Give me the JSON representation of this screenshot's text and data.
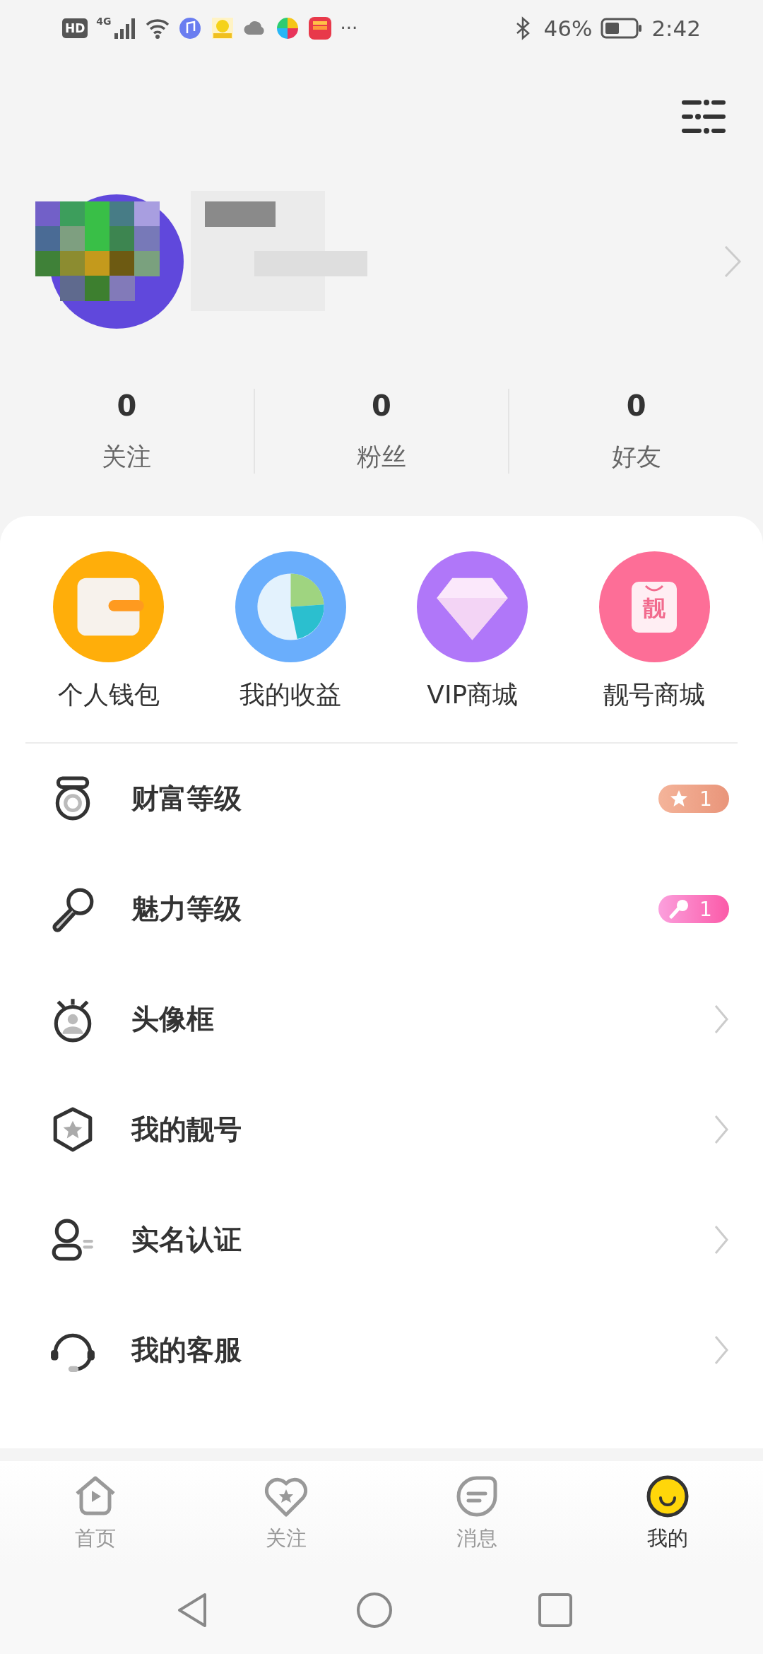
{
  "status_bar": {
    "hd": "HD",
    "network": "4G",
    "more": "···",
    "battery": "46%",
    "time": "2:42"
  },
  "stats": [
    {
      "value": "0",
      "label": "关注"
    },
    {
      "value": "0",
      "label": "粉丝"
    },
    {
      "value": "0",
      "label": "好友"
    }
  ],
  "shortcuts": [
    {
      "label": "个人钱包",
      "kind": "wallet",
      "color": "#ffae0a"
    },
    {
      "label": "我的收益",
      "kind": "chart",
      "color": "#6aaefc"
    },
    {
      "label": "VIP商城",
      "kind": "diamond",
      "color": "#b077f9"
    },
    {
      "label": "靓号商城",
      "kind": "bag",
      "color": "#fd6e97",
      "glyph": "靓"
    }
  ],
  "menu": [
    {
      "label": "财富等级",
      "kind": "medal",
      "trailing": {
        "kind": "star",
        "text": "1"
      }
    },
    {
      "label": "魅力等级",
      "kind": "mic",
      "trailing": {
        "kind": "mic",
        "text": "1"
      }
    },
    {
      "label": "头像框",
      "kind": "frame",
      "trailing": {
        "kind": "chevron"
      }
    },
    {
      "label": "我的靓号",
      "kind": "hexstar",
      "trailing": {
        "kind": "chevron"
      }
    },
    {
      "label": "实名认证",
      "kind": "person",
      "trailing": {
        "kind": "chevron"
      }
    },
    {
      "label": "我的客服",
      "kind": "headset",
      "trailing": {
        "kind": "chevron"
      }
    }
  ],
  "tabs": [
    {
      "label": "首页",
      "kind": "home",
      "selected": false
    },
    {
      "label": "关注",
      "kind": "heart",
      "selected": false
    },
    {
      "label": "消息",
      "kind": "message",
      "selected": false
    },
    {
      "label": "我的",
      "kind": "me",
      "selected": true
    }
  ]
}
